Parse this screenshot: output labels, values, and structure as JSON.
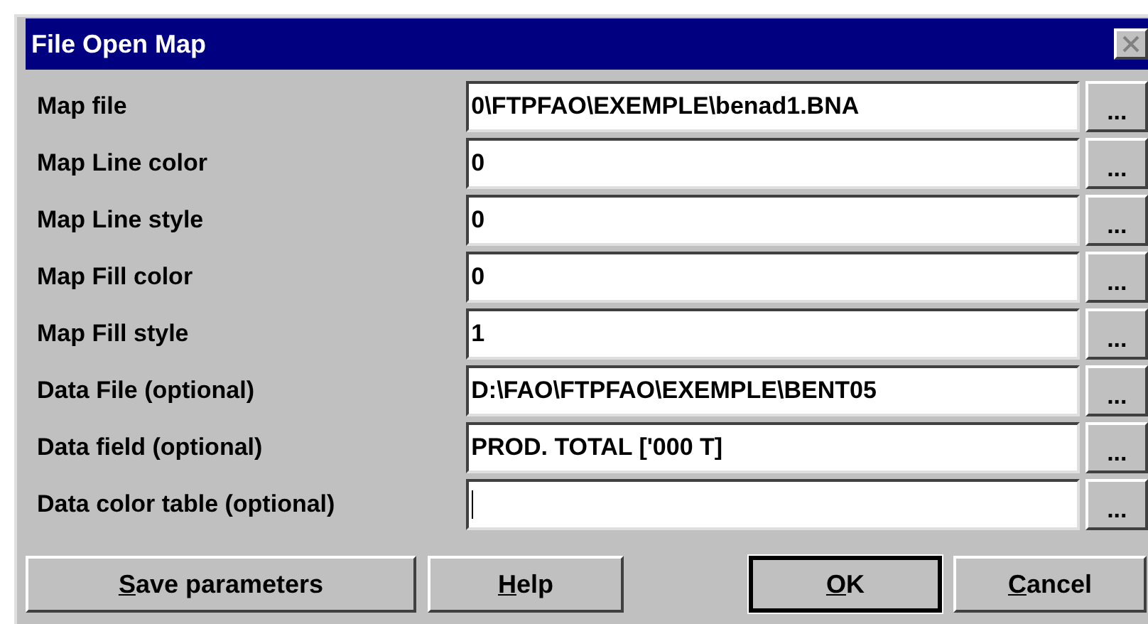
{
  "window": {
    "title": "File Open Map",
    "close_disabled": true
  },
  "fields": [
    {
      "label": "Map file",
      "value": "0\\FTPFAO\\EXEMPLE\\benad1.BNA",
      "browse": "...",
      "focused": false
    },
    {
      "label": "Map Line color",
      "value": "0",
      "browse": "...",
      "focused": false
    },
    {
      "label": "Map Line style",
      "value": "0",
      "browse": "...",
      "focused": false
    },
    {
      "label": "Map Fill color",
      "value": "0",
      "browse": "...",
      "focused": false
    },
    {
      "label": "Map Fill style",
      "value": "1",
      "browse": "...",
      "focused": false
    },
    {
      "label": "Data File (optional)",
      "value": "D:\\FAO\\FTPFAO\\EXEMPLE\\BENT05",
      "browse": "...",
      "focused": false
    },
    {
      "label": "Data field (optional)",
      "value": "PROD. TOTAL ['000 T]",
      "browse": "...",
      "focused": false
    },
    {
      "label": "Data color table (optional)",
      "browse": "...",
      "focused": true
    }
  ],
  "buttons": [
    {
      "segments": [
        {
          "text": "S",
          "underline": true
        },
        {
          "text": "ave parameters",
          "underline": false
        }
      ],
      "default": false
    },
    {
      "segments": [
        {
          "text": "H",
          "underline": true
        },
        {
          "text": "elp",
          "underline": false
        }
      ],
      "default": false
    },
    {
      "segments": [
        {
          "text": "O",
          "underline": true
        },
        {
          "text": "K",
          "underline": false
        }
      ],
      "default": true
    },
    {
      "segments": [
        {
          "text": "C",
          "underline": true
        },
        {
          "text": "ancel",
          "underline": false
        }
      ],
      "default": false
    }
  ]
}
